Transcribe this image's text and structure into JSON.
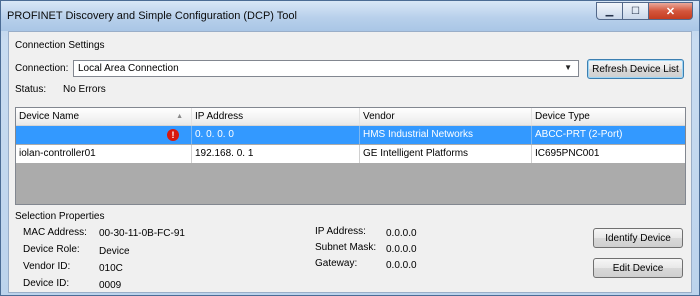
{
  "window": {
    "title": "PROFINET Discovery and Simple Configuration (DCP) Tool",
    "min_glyph": "▁",
    "max_glyph": "☐",
    "close_glyph": "✕"
  },
  "connection": {
    "heading": "Connection Settings",
    "connection_label": "Connection:",
    "connection_value": "Local Area Connection",
    "dropdown_glyph": "▼",
    "status_label": "Status:",
    "status_value": "No Errors",
    "refresh_button": "Refresh Device List"
  },
  "table": {
    "columns": [
      "Device Name",
      "IP Address",
      "Vendor",
      "Device Type"
    ],
    "sort_glyph": "▲",
    "error_glyph": "!",
    "rows": [
      [
        "",
        "0. 0. 0. 0",
        "HMS Industrial Networks",
        "ABCC-PRT (2-Port)"
      ],
      [
        "iolan-controller01",
        "192.168. 0. 1",
        "GE Intelligent Platforms",
        "IC695PNC001"
      ]
    ]
  },
  "selection": {
    "heading": "Selection Properties",
    "mac_label": "MAC Address:",
    "mac_value": "00-30-11-0B-FC-91",
    "role_label": "Device Role:",
    "role_value": "Device",
    "vendor_label": "Vendor ID:",
    "vendor_value": "010C",
    "device_label": "Device ID:",
    "device_value": "0009",
    "ip_label": "IP Address:",
    "ip_value": "0.0.0.0",
    "subnet_label": "Subnet Mask:",
    "subnet_value": "0.0.0.0",
    "gateway_label": "Gateway:",
    "gateway_value": "0.0.0.0",
    "identify_button": "Identify Device",
    "edit_button": "Edit Device"
  },
  "colors": {
    "selection_highlight": "#3399ff",
    "error_badge": "#d8180e",
    "close_button": "#c43c20"
  }
}
